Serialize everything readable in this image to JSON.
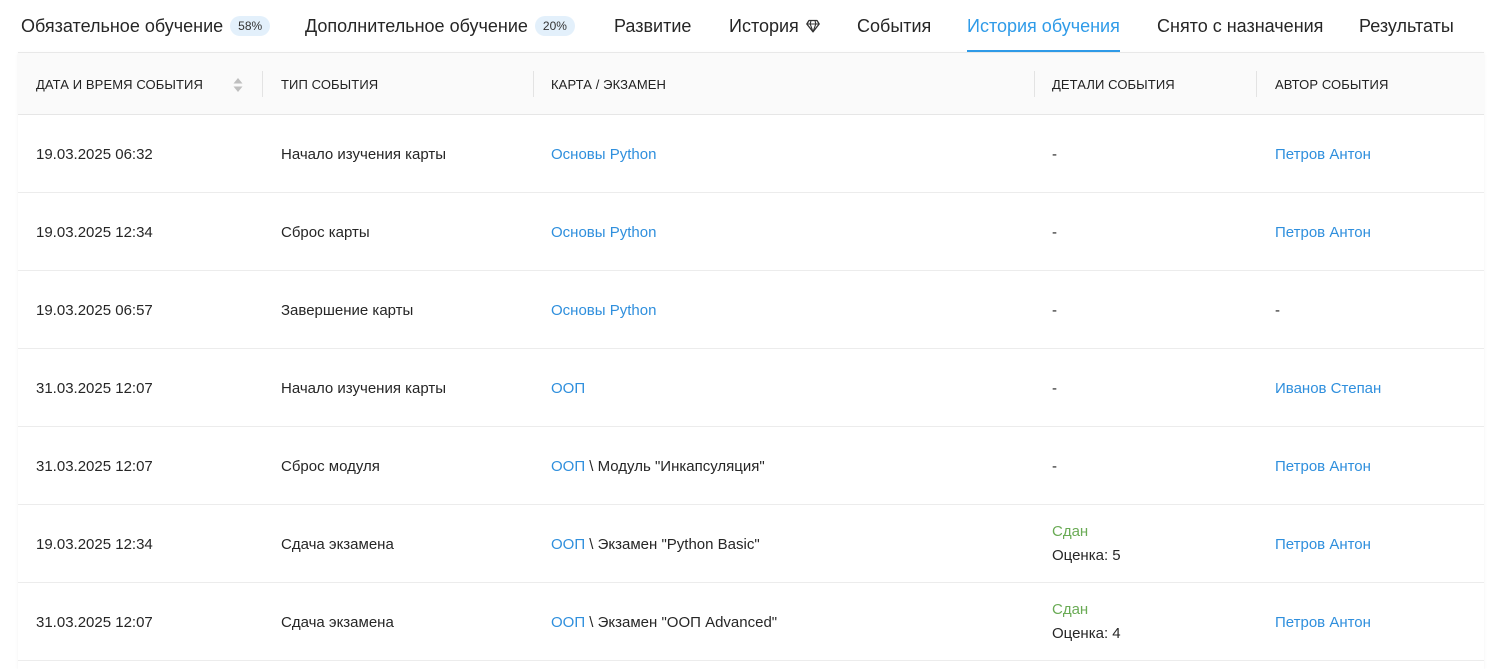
{
  "tabs": [
    {
      "label": "Обязательное обучение",
      "badge": "58%"
    },
    {
      "label": "Дополнительное обучение",
      "badge": "20%"
    },
    {
      "label": "Развитие"
    },
    {
      "label": "История",
      "icon": "diamond-icon"
    },
    {
      "label": "События"
    },
    {
      "label": "История обучения",
      "active": true
    },
    {
      "label": "Снято с назначения"
    },
    {
      "label": "Результаты"
    }
  ],
  "table": {
    "columns": [
      "ДАТА И ВРЕМЯ СОБЫТИЯ",
      "ТИП СОБЫТИЯ",
      "КАРТА / ЭКЗАМЕН",
      "ДЕТАЛИ СОБЫТИЯ",
      "АВТОР СОБЫТИЯ"
    ],
    "rows": [
      {
        "datetime": "19.03.2025 06:32",
        "type": "Начало изучения карты",
        "card": "Основы Python",
        "card_suffix": "",
        "details": "-",
        "details_status": "",
        "details_grade": "",
        "author": "Петров Антон",
        "author_link": true
      },
      {
        "datetime": "19.03.2025 12:34",
        "type": "Сброс карты",
        "card": "Основы Python",
        "card_suffix": "",
        "details": "-",
        "details_status": "",
        "details_grade": "",
        "author": "Петров Антон",
        "author_link": true
      },
      {
        "datetime": "19.03.2025 06:57",
        "type": "Завершение карты",
        "card": "Основы Python",
        "card_suffix": "",
        "details": "-",
        "details_status": "",
        "details_grade": "",
        "author": "-",
        "author_link": false
      },
      {
        "datetime": "31.03.2025 12:07",
        "type": "Начало изучения карты",
        "card": "ООП",
        "card_suffix": "",
        "details": "-",
        "details_status": "",
        "details_grade": "",
        "author": "Иванов Степан",
        "author_link": true
      },
      {
        "datetime": "31.03.2025 12:07",
        "type": "Сброс модуля",
        "card": "ООП",
        "card_suffix": "\\ Модуль \"Инкапсуляция\"",
        "details": "-",
        "details_status": "",
        "details_grade": "",
        "author": "Петров Антон",
        "author_link": true
      },
      {
        "datetime": "19.03.2025 12:34",
        "type": "Сдача экзамена",
        "card": "ООП",
        "card_suffix": "\\ Экзамен \"Python Basic\"",
        "details": "",
        "details_status": "Сдан",
        "details_grade": "Оценка: 5",
        "author": "Петров Антон",
        "author_link": true
      },
      {
        "datetime": "31.03.2025 12:07",
        "type": "Сдача экзамена",
        "card": "ООП",
        "card_suffix": "\\ Экзамен \"ООП Advanced\"",
        "details": "",
        "details_status": "Сдан",
        "details_grade": "Оценка: 4",
        "author": "Петров Антон",
        "author_link": true
      }
    ]
  },
  "colors": {
    "accent": "#2f9be8",
    "link": "#2f8fdd",
    "success": "#6aab55"
  }
}
